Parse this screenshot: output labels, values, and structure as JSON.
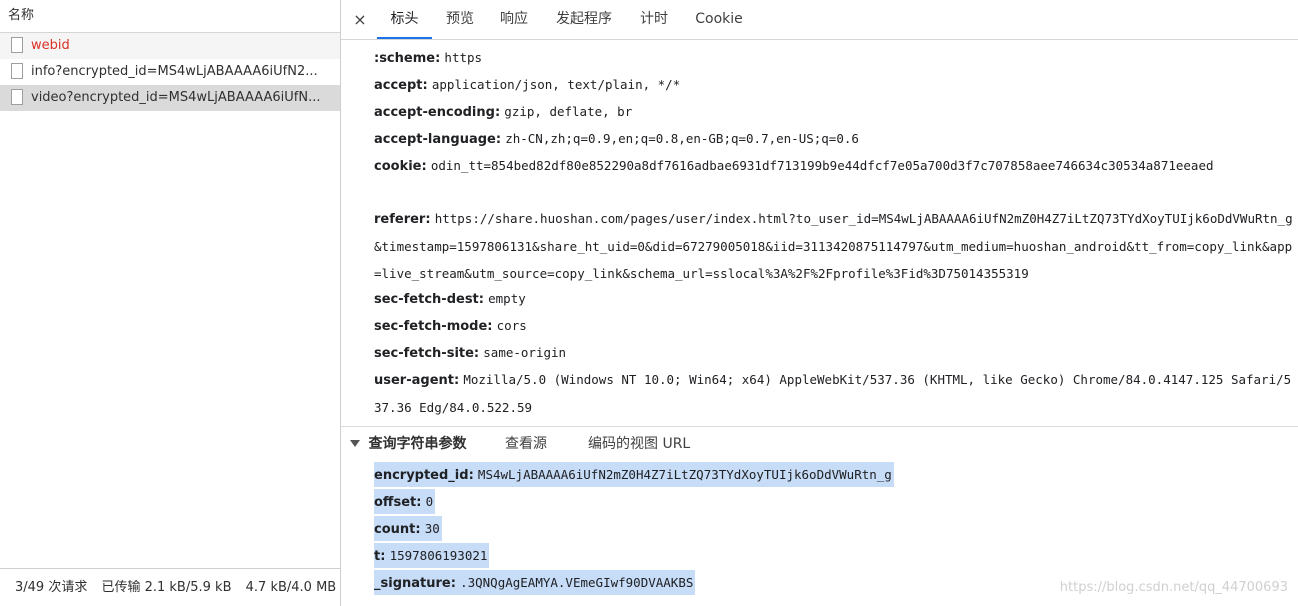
{
  "left": {
    "header": "名称",
    "requests": [
      {
        "name": "webid",
        "style": "error"
      },
      {
        "name": "info?encrypted_id=MS4wLjABAAAA6iUfN2...",
        "style": "normal"
      },
      {
        "name": "video?encrypted_id=MS4wLjABAAAA6iUfN...",
        "style": "selected"
      }
    ],
    "footer": {
      "requests": "3/49 次请求",
      "transferred": "已传输 2.1 kB/5.9 kB",
      "resources": "4.7 kB/4.0 MB"
    }
  },
  "tabs": {
    "close": "×",
    "items": [
      "标头",
      "预览",
      "响应",
      "发起程序",
      "计时",
      "Cookie"
    ],
    "active": "标头"
  },
  "headers": [
    {
      "name": ":scheme:",
      "value": "https"
    },
    {
      "name": "accept:",
      "value": "application/json, text/plain, */*"
    },
    {
      "name": "accept-encoding:",
      "value": "gzip, deflate, br"
    },
    {
      "name": "accept-language:",
      "value": "zh-CN,zh;q=0.9,en;q=0.8,en-GB;q=0.7,en-US;q=0.6"
    },
    {
      "name": "cookie:",
      "value": "odin_tt=854bed82df80e852290a8df7616adbae6931df713199b9e44dfcf7e05a700d3f7c707858aee746634c30534a871eeaed"
    },
    {
      "name": "referer:",
      "value": "https://share.huoshan.com/pages/user/index.html?to_user_id=MS4wLjABAAAA6iUfN2mZ0H4Z7iLtZQ73TYdXoyTUIjk6oDdVWuRtn_g&timestamp=1597806131&share_ht_uid=0&did=67279005018&iid=3113420875114797&utm_medium=huoshan_android&tt_from=copy_link&app=live_stream&utm_source=copy_link&schema_url=sslocal%3A%2F%2Fprofile%3Fid%3D75014355319"
    },
    {
      "name": "sec-fetch-dest:",
      "value": "empty"
    },
    {
      "name": "sec-fetch-mode:",
      "value": "cors"
    },
    {
      "name": "sec-fetch-site:",
      "value": "same-origin"
    },
    {
      "name": "user-agent:",
      "value": "Mozilla/5.0 (Windows NT 10.0; Win64; x64) AppleWebKit/537.36 (KHTML, like Gecko) Chrome/84.0.4147.125 Safari/537.36 Edg/84.0.522.59"
    }
  ],
  "query": {
    "title": "查询字符串参数",
    "view_source": "查看源",
    "view_url_encoded": "编码的视图 URL",
    "params": [
      {
        "name": "encrypted_id:",
        "value": "MS4wLjABAAAA6iUfN2mZ0H4Z7iLtZQ73TYdXoyTUIjk6oDdVWuRtn_g"
      },
      {
        "name": "offset:",
        "value": "0"
      },
      {
        "name": "count:",
        "value": "30"
      },
      {
        "name": "t:",
        "value": "1597806193021"
      },
      {
        "name": "_signature:",
        "value": ".3QNQgAgEAMYA.VEmeGIwf90DVAAKBS"
      }
    ]
  },
  "watermark": "https://blog.csdn.net/qq_44700693"
}
